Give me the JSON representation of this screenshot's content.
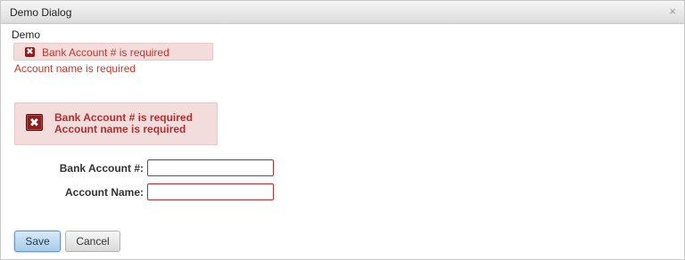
{
  "dialog": {
    "title": "Demo Dialog",
    "close_glyph": "×"
  },
  "demo_label": "Demo",
  "inline_message": {
    "icon_glyph": "✖",
    "text": "Bank Account # is required"
  },
  "standalone_message": "Account name is required",
  "message_box": {
    "icon_glyph": "✖",
    "lines": [
      "Bank Account # is required",
      "Account name is required"
    ]
  },
  "form": {
    "fields": [
      {
        "label": "Bank Account #:",
        "value": ""
      },
      {
        "label": "Account Name:",
        "value": ""
      }
    ]
  },
  "buttons": {
    "save_label": "Save",
    "cancel_label": "Cancel"
  },
  "colors": {
    "error_text": "#c0392b",
    "error_bg": "#f3dcdc",
    "error_icon": "#8d1e1e"
  }
}
